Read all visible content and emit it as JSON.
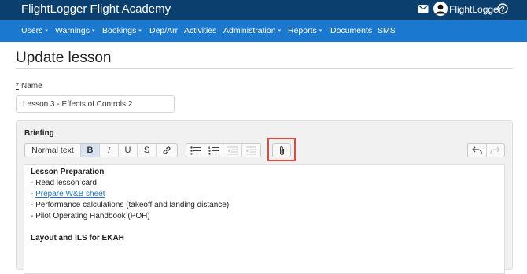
{
  "header": {
    "app_title": "FlightLogger Flight Academy",
    "username": "FlightLogger",
    "icons": [
      "mail-icon",
      "avatar-icon",
      "help-icon"
    ]
  },
  "nav": {
    "items": [
      {
        "label": "Users",
        "caret": "▾"
      },
      {
        "label": "Warnings",
        "caret": "▾"
      },
      {
        "label": "Bookings",
        "caret": "▾"
      },
      {
        "label": "Dep/Arr"
      },
      {
        "label": "Activities"
      },
      {
        "label": "Administration",
        "caret": "▾"
      },
      {
        "label": "Reports",
        "caret": "▾"
      },
      {
        "label": "Documents"
      },
      {
        "label": "SMS"
      }
    ]
  },
  "page": {
    "title": "Update lesson",
    "name_required_mark": "*",
    "name_label": "Name",
    "name_value": "Lesson 3 - Effects of Controls 2"
  },
  "briefing": {
    "label": "Briefing",
    "toolbar": {
      "style_select": "Normal text",
      "bold": "B",
      "italic": "I",
      "underline": "U",
      "strikethrough": "S"
    },
    "content": {
      "heading1": "Lesson Preparation",
      "item1": "- Read lesson card",
      "item2_prefix": "- ",
      "item2_link": "Prepare W&B sheet",
      "item3": "- Performance calculations (takeoff and landing distance)",
      "item4": "- Pilot Operating Handbook (POH)",
      "heading2": "Layout and ILS for EKAH"
    }
  },
  "colors": {
    "topbar": "#0b3f6e",
    "navbar": "#1a78cf",
    "link": "#1a78cf",
    "highlight": "#e04b3f"
  }
}
